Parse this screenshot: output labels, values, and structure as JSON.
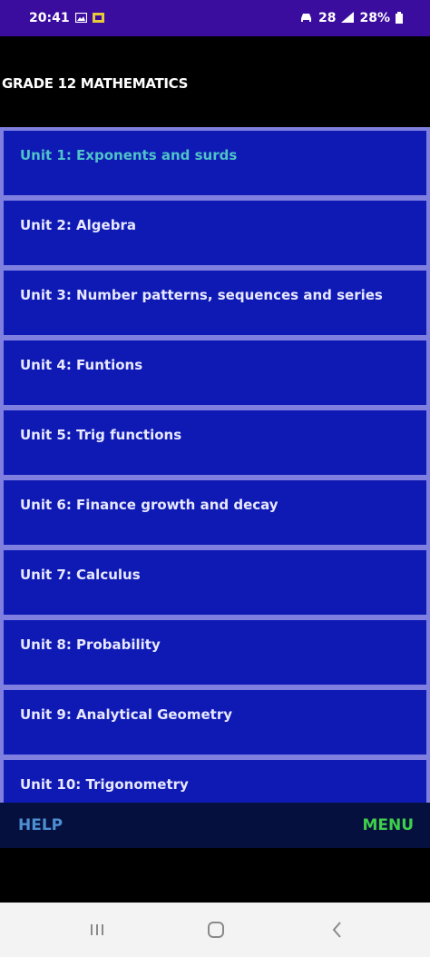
{
  "status_bar": {
    "time": "20:41",
    "battery": "28%",
    "signal_text": "28"
  },
  "header": {
    "title": "GRADE 12 MATHEMATICS"
  },
  "units": [
    {
      "label": "Unit 1: Exponents and surds",
      "active": true
    },
    {
      "label": "Unit 2: Algebra"
    },
    {
      "label": "Unit 3: Number patterns, sequences and series"
    },
    {
      "label": "Unit 4: Funtions"
    },
    {
      "label": "Unit 5: Trig functions"
    },
    {
      "label": "Unit 6: Finance growth and decay"
    },
    {
      "label": "Unit 7: Calculus"
    },
    {
      "label": "Unit 8: Probability"
    },
    {
      "label": "Unit 9: Analytical Geometry"
    },
    {
      "label": "Unit 10: Trigonometry"
    }
  ],
  "bottom_bar": {
    "help_label": "HELP",
    "menu_label": "MENU"
  },
  "colors": {
    "status_bar": "#3a0d9e",
    "unit_background": "#0f1ab4",
    "active_unit_text": "#4fc3c8",
    "help": "#4d8fd1",
    "menu": "#3ecf4a"
  },
  "icons": {
    "status_left": [
      "gallery-icon",
      "notification-icon"
    ],
    "status_right": [
      "car-mode-icon",
      "signal-icon",
      "battery-icon"
    ],
    "nav": [
      "recents-icon",
      "home-icon",
      "back-icon"
    ]
  }
}
